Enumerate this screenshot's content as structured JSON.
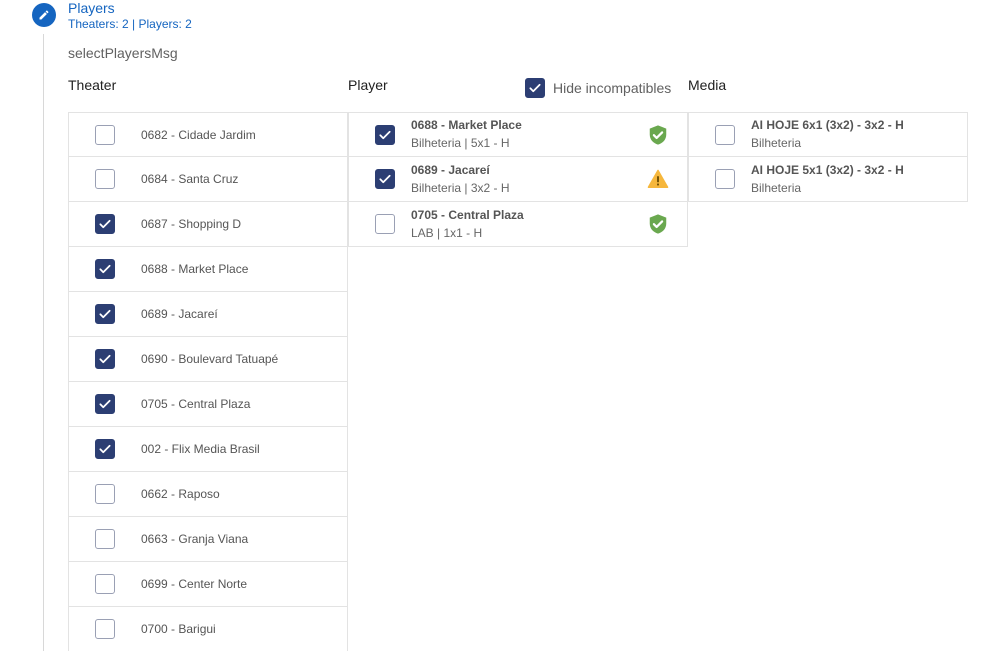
{
  "step": {
    "title": "Players",
    "subtitle": "Theaters: 2 | Players: 2",
    "message": "selectPlayersMsg",
    "icon": "pencil-icon"
  },
  "columns": {
    "theater": "Theater",
    "player": "Player",
    "media": "Media"
  },
  "hide_incompatibles": {
    "label": "Hide incompatibles",
    "checked": true
  },
  "theaters": [
    {
      "name": "0682 - Cidade Jardim",
      "checked": false
    },
    {
      "name": "0684 - Santa Cruz",
      "checked": false
    },
    {
      "name": "0687 - Shopping D",
      "checked": true
    },
    {
      "name": "0688 - Market Place",
      "checked": true
    },
    {
      "name": "0689 - Jacareí",
      "checked": true
    },
    {
      "name": "0690 - Boulevard Tatuapé",
      "checked": true
    },
    {
      "name": "0705 - Central Plaza",
      "checked": true
    },
    {
      "name": "002 - Flix Media Brasil",
      "checked": true
    },
    {
      "name": "0662 - Raposo",
      "checked": false
    },
    {
      "name": "0663 - Granja Viana",
      "checked": false
    },
    {
      "name": "0699 - Center Norte",
      "checked": false
    },
    {
      "name": "0700 - Barigui",
      "checked": false
    }
  ],
  "players": [
    {
      "name": "0688 - Market Place",
      "detail": "Bilheteria | 5x1 - H",
      "checked": true,
      "status": "shield-check-icon",
      "status_color": "#6aa84f"
    },
    {
      "name": "0689 - Jacareí",
      "detail": "Bilheteria | 3x2 - H",
      "checked": true,
      "status": "warning-icon",
      "status_color": "#f6b73c"
    },
    {
      "name": "0705 - Central Plaza",
      "detail": "LAB | 1x1 - H",
      "checked": false,
      "status": "shield-check-icon",
      "status_color": "#6aa84f"
    }
  ],
  "media": [
    {
      "name": "AI HOJE 6x1 (3x2) - 3x2 - H",
      "detail": "Bilheteria",
      "checked": false
    },
    {
      "name": "AI HOJE 5x1 (3x2) - 3x2 - H",
      "detail": "Bilheteria",
      "checked": false
    }
  ],
  "colors": {
    "accent": "#1565c0",
    "checkbox_checked": "#2c3e73",
    "ok": "#6aa84f",
    "warn": "#f6b73c"
  }
}
